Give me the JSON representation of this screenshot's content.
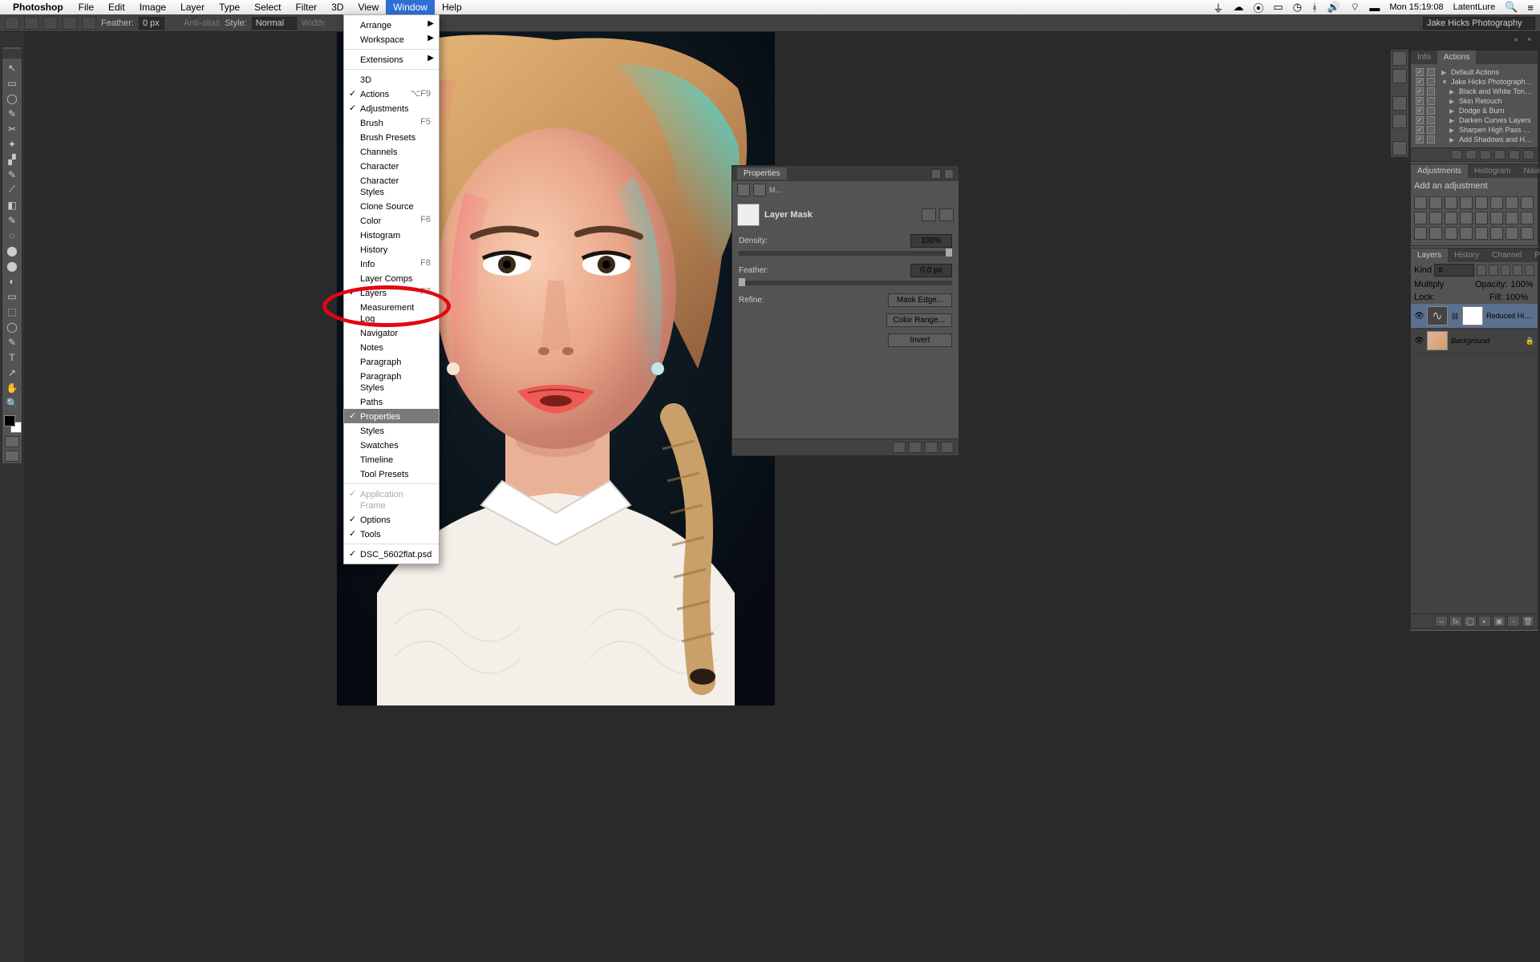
{
  "menubar": {
    "app": "Photoshop",
    "items": [
      "File",
      "Edit",
      "Image",
      "Layer",
      "Type",
      "Select",
      "Filter",
      "3D",
      "View",
      "Window",
      "Help"
    ],
    "active": "Window",
    "right": {
      "clock": "Mon 15:19:08",
      "user": "LatentLure"
    }
  },
  "options_bar": {
    "feather_label": "Feather:",
    "feather_value": "0 px",
    "antialias": "Anti-alias",
    "style_label": "Style:",
    "style_value": "Normal",
    "width_label": "Width:",
    "workspace_name": "Jake Hicks Photography"
  },
  "window_menu": {
    "groups": [
      [
        {
          "label": "Arrange",
          "sub": true
        },
        {
          "label": "Workspace",
          "sub": true
        }
      ],
      [
        {
          "label": "Extensions",
          "sub": true
        }
      ],
      [
        {
          "label": "3D"
        },
        {
          "label": "Actions",
          "check": true,
          "shortcut": "⌥F9"
        },
        {
          "label": "Adjustments",
          "check": true
        },
        {
          "label": "Brush",
          "shortcut": "F5"
        },
        {
          "label": "Brush Presets"
        },
        {
          "label": "Channels"
        },
        {
          "label": "Character"
        },
        {
          "label": "Character Styles"
        },
        {
          "label": "Clone Source"
        },
        {
          "label": "Color",
          "shortcut": "F6"
        },
        {
          "label": "Histogram"
        },
        {
          "label": "History"
        },
        {
          "label": "Info",
          "shortcut": "F8"
        },
        {
          "label": "Layer Comps"
        },
        {
          "label": "Layers",
          "check": true,
          "shortcut": "F7"
        },
        {
          "label": "Measurement Log"
        },
        {
          "label": "Navigator"
        },
        {
          "label": "Notes"
        },
        {
          "label": "Paragraph"
        },
        {
          "label": "Paragraph Styles"
        },
        {
          "label": "Paths"
        },
        {
          "label": "Properties",
          "check": true,
          "highlighted": true
        },
        {
          "label": "Styles"
        },
        {
          "label": "Swatches"
        },
        {
          "label": "Timeline"
        },
        {
          "label": "Tool Presets"
        }
      ],
      [
        {
          "label": "Application Frame",
          "check": true,
          "disabled": true
        },
        {
          "label": "Options",
          "check": true
        },
        {
          "label": "Tools",
          "check": true
        }
      ],
      [
        {
          "label": "DSC_5602flat.psd",
          "check": true
        }
      ]
    ]
  },
  "properties": {
    "title": "Properties",
    "sub_label": "M...",
    "mask_label": "Layer Mask",
    "density_label": "Density:",
    "density_value": "100%",
    "feather_label": "Feather:",
    "feather_value": "0.0 px",
    "refine_label": "Refine:",
    "mask_edge_btn": "Mask Edge...",
    "color_range_btn": "Color Range...",
    "invert_btn": "Invert"
  },
  "actions_panel": {
    "tabs": [
      "Info",
      "Actions"
    ],
    "active_tab": "Actions",
    "items": [
      {
        "label": "Default Actions",
        "folder": true,
        "indent": 0
      },
      {
        "label": "Jake Hicks Photography ...",
        "folder": true,
        "open": true,
        "indent": 0
      },
      {
        "label": "Black and White Tone Pr...",
        "indent": 1
      },
      {
        "label": "Skin Retouch",
        "indent": 1
      },
      {
        "label": "Dodge & Burn",
        "indent": 1
      },
      {
        "label": "Darken Curves Layers",
        "indent": 1
      },
      {
        "label": "Sharpen High Pass Set",
        "indent": 1
      },
      {
        "label": "Add Shadows and Highli...",
        "indent": 1
      }
    ]
  },
  "adjustments_panel": {
    "tabs": [
      "Adjustments",
      "Histogram",
      "Navigato"
    ],
    "heading": "Add an adjustment"
  },
  "layers_panel": {
    "tabs": [
      "Layers",
      "History",
      "Channel",
      "Paths"
    ],
    "kind_label": "Kind",
    "blend_mode": "Multiply",
    "opacity_label": "Opacity:",
    "opacity_value": "100%",
    "lock_label": "Lock:",
    "fill_label": "Fill:",
    "fill_value": "100%",
    "layers": [
      {
        "name": "Reduced Highli...",
        "type": "adjustment",
        "selected": true
      },
      {
        "name": "Background",
        "type": "image",
        "locked": true
      }
    ]
  },
  "tools": [
    "↖",
    "▭",
    "◯",
    "✎",
    "✂",
    "✦",
    "▞",
    "✎",
    "⟋",
    "◧",
    "✎",
    "◌",
    "⬤",
    "⬤",
    "◐",
    "▭",
    "⬚",
    "◯",
    "✎",
    "T",
    "↗",
    "✋",
    "🔍"
  ]
}
